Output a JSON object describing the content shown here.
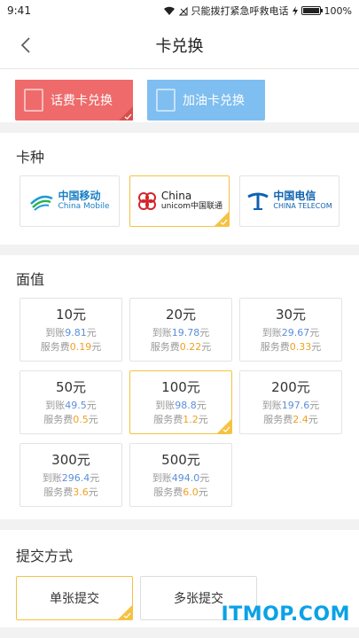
{
  "status_bar": {
    "time": "9:41",
    "carrier_text": "只能拨打紧急呼救电话",
    "battery": "100%",
    "battery_level": 1.0
  },
  "nav": {
    "title": "卡兑换"
  },
  "exchange_types": [
    {
      "label": "话费卡兑换",
      "selected": true
    },
    {
      "label": "加油卡兑换",
      "selected": false
    }
  ],
  "card_type": {
    "title": "卡种",
    "carriers": [
      {
        "cn": "中国移动",
        "en": "China Mobile",
        "selected": false
      },
      {
        "cn": "China",
        "en": "unicom中国联通",
        "selected": true
      },
      {
        "cn": "中国电信",
        "en": "CHINA TELECOM",
        "selected": false
      }
    ]
  },
  "denomination": {
    "title": "面值",
    "credit_prefix": "到账",
    "fee_prefix": "服务费",
    "currency": "元",
    "items": [
      {
        "value": "10元",
        "credit": "9.81",
        "fee": "0.19",
        "selected": false
      },
      {
        "value": "20元",
        "credit": "19.78",
        "fee": "0.22",
        "selected": false
      },
      {
        "value": "30元",
        "credit": "29.67",
        "fee": "0.33",
        "selected": false
      },
      {
        "value": "50元",
        "credit": "49.5",
        "fee": "0.5",
        "selected": false
      },
      {
        "value": "100元",
        "credit": "98.8",
        "fee": "1.2",
        "selected": true
      },
      {
        "value": "200元",
        "credit": "197.6",
        "fee": "2.4",
        "selected": false
      },
      {
        "value": "300元",
        "credit": "296.4",
        "fee": "3.6",
        "selected": false
      },
      {
        "value": "500元",
        "credit": "494.0",
        "fee": "6.0",
        "selected": false
      }
    ]
  },
  "submit": {
    "title": "提交方式",
    "options": [
      {
        "label": "单张提交",
        "selected": true
      },
      {
        "label": "多张提交",
        "selected": false
      }
    ]
  },
  "watermark": "ITMOP.COM",
  "colors": {
    "accent": "#f5c242",
    "red": "#ef6a6a",
    "blue": "#7fbef0",
    "credit": "#5b8fd8",
    "fee": "#f0a020"
  }
}
